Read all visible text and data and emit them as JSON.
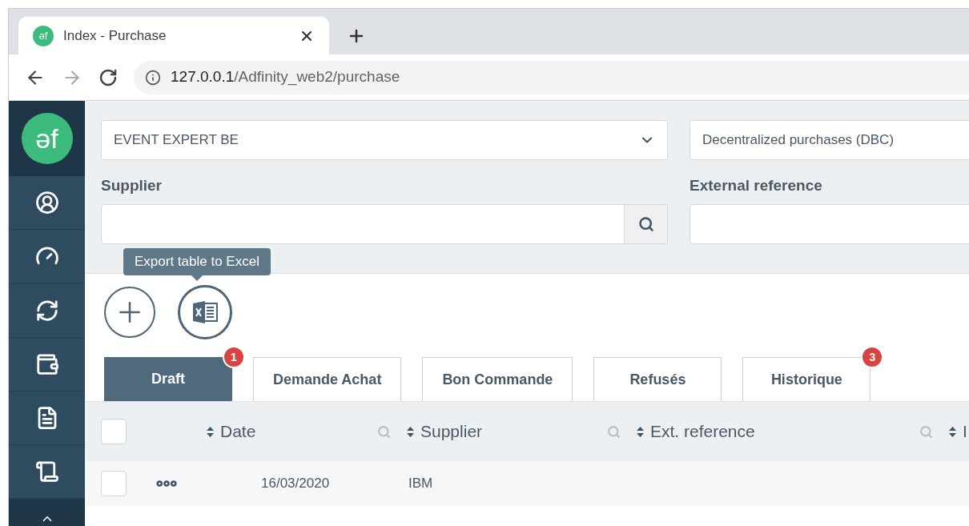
{
  "browser": {
    "tab_title": "Index - Purchase",
    "favicon_text": "əf",
    "url_host": "127.0.0.1",
    "url_path": "/Adfinity_web2/purchase"
  },
  "sidebar": {
    "logo_text": "əf",
    "items": [
      {
        "kind": "user"
      },
      {
        "kind": "gauge"
      },
      {
        "kind": "refresh"
      },
      {
        "kind": "wallet"
      },
      {
        "kind": "document"
      },
      {
        "kind": "receipt"
      },
      {
        "kind": "more"
      }
    ]
  },
  "filters": {
    "company": "EVENT EXPERT BE",
    "journal": "Decentralized purchases (DBC)",
    "supplier_label": "Supplier",
    "external_reference_label": "External reference"
  },
  "tooltip": "Export table to Excel",
  "tabs": [
    {
      "label": "Draft",
      "selected": true,
      "badge": "1"
    },
    {
      "label": "Demande Achat",
      "selected": false
    },
    {
      "label": "Bon Commande",
      "selected": false
    },
    {
      "label": "Refusés",
      "selected": false
    },
    {
      "label": "Historique",
      "selected": false,
      "badge": "3"
    }
  ],
  "table": {
    "all_checked": false,
    "columns": [
      {
        "label": "Date"
      },
      {
        "label": "Supplier"
      },
      {
        "label": "Ext. reference"
      },
      {
        "label": "I"
      }
    ],
    "rows": [
      {
        "checked": false,
        "cells": [
          "16/03/2020",
          "IBM",
          ""
        ]
      }
    ]
  }
}
